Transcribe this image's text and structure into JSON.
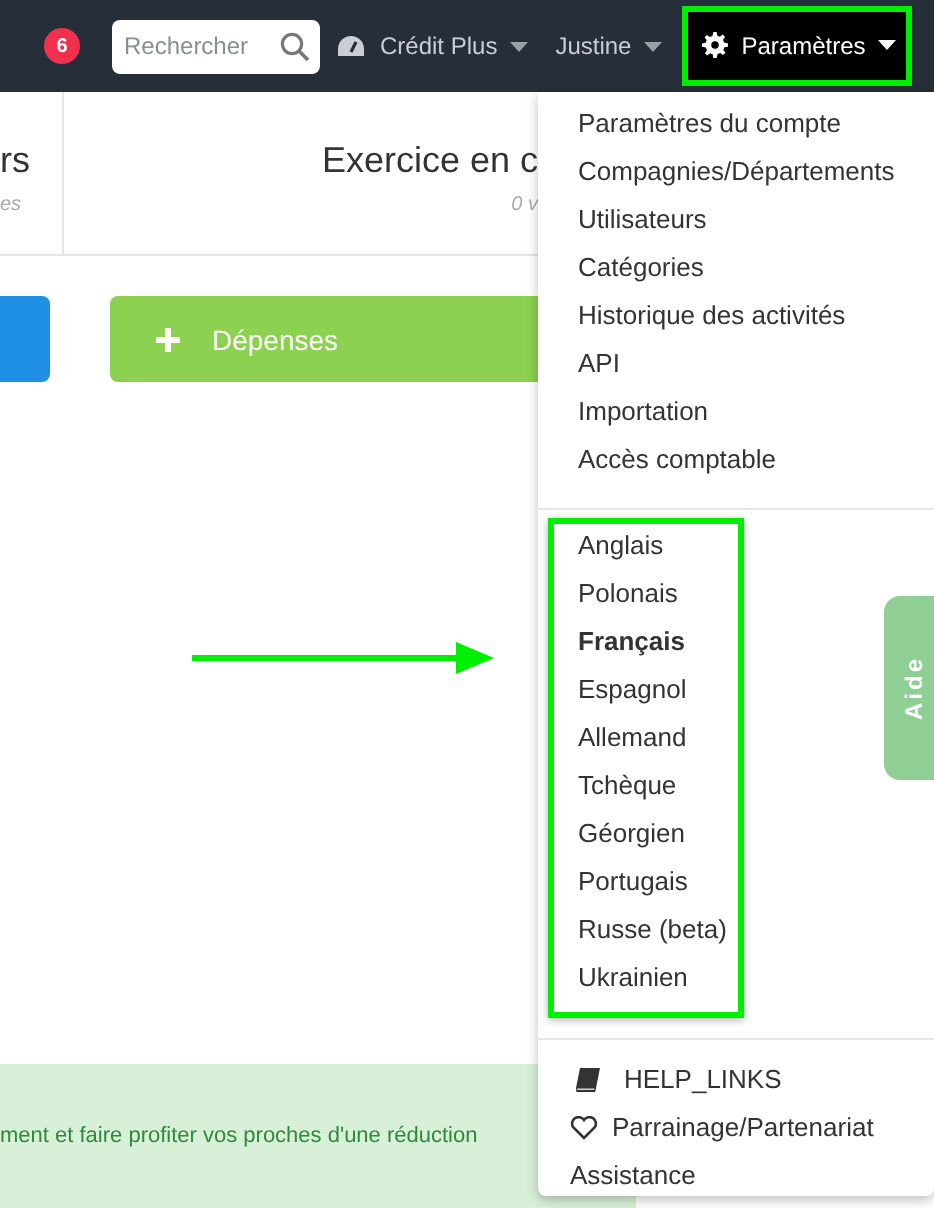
{
  "navbar": {
    "notification_count": "6",
    "search": {
      "placeholder": "Rechercher"
    },
    "menus": [
      {
        "label": "Crédit Plus",
        "kind": "gauge",
        "active": false,
        "highlighted": false
      },
      {
        "label": "Justine",
        "kind": "plain",
        "active": false,
        "highlighted": false
      },
      {
        "label": "Paramètres",
        "kind": "gear",
        "active": true,
        "highlighted": true
      }
    ]
  },
  "stats": [
    {
      "title": "rs",
      "subtitle": "es"
    },
    {
      "title": "Exercice en c",
      "subtitle": "0 v"
    }
  ],
  "actions": [
    {
      "color": "#1f8fe6"
    },
    {
      "label": "Dépenses",
      "color": "#8cd14f"
    }
  ],
  "banner": {
    "text": "ment et faire profiter vos proches d'une réduction"
  },
  "help_tab": {
    "label": "Aide"
  },
  "arrow": {
    "shown": true
  },
  "dropdown": {
    "account_items": [
      "Paramètres du compte",
      "Compagnies/Départements",
      "Utilisateurs",
      "Catégories",
      "Historique des activités",
      "API",
      "Importation",
      "Accès comptable"
    ],
    "languages_highlighted": true,
    "languages": [
      {
        "label": "Anglais",
        "selected": false
      },
      {
        "label": "Polonais",
        "selected": false
      },
      {
        "label": "Français",
        "selected": true
      },
      {
        "label": "Espagnol",
        "selected": false
      },
      {
        "label": "Allemand",
        "selected": false
      },
      {
        "label": "Tchèque",
        "selected": false
      },
      {
        "label": "Géorgien",
        "selected": false
      },
      {
        "label": "Portugais",
        "selected": false
      },
      {
        "label": "Russe (beta)",
        "selected": false
      },
      {
        "label": "Ukrainien",
        "selected": false
      }
    ],
    "footer_items": [
      {
        "label": "HELP_LINKS",
        "kind": "book"
      },
      {
        "label": "Parrainage/Partenariat",
        "kind": "heart"
      },
      {
        "label": "Assistance",
        "kind": "plain"
      }
    ]
  }
}
